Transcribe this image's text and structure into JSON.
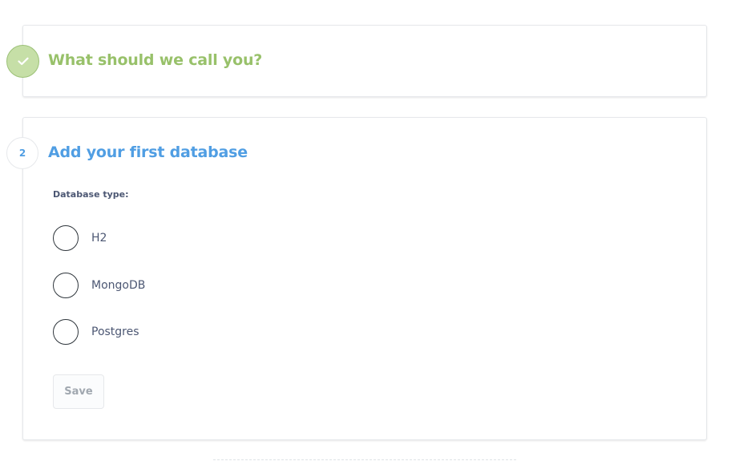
{
  "steps": [
    {
      "status": "complete",
      "title": "What should we call you?",
      "badge_icon": "check-icon",
      "color": "#98c16a"
    },
    {
      "status": "active",
      "number": "2",
      "title": "Add your first database",
      "color": "#509ee3"
    }
  ],
  "database_form": {
    "label": "Database type:",
    "options": [
      {
        "label": "H2",
        "selected": false
      },
      {
        "label": "MongoDB",
        "selected": false
      },
      {
        "label": "Postgres",
        "selected": false
      }
    ],
    "save_label": "Save",
    "save_enabled": false
  }
}
